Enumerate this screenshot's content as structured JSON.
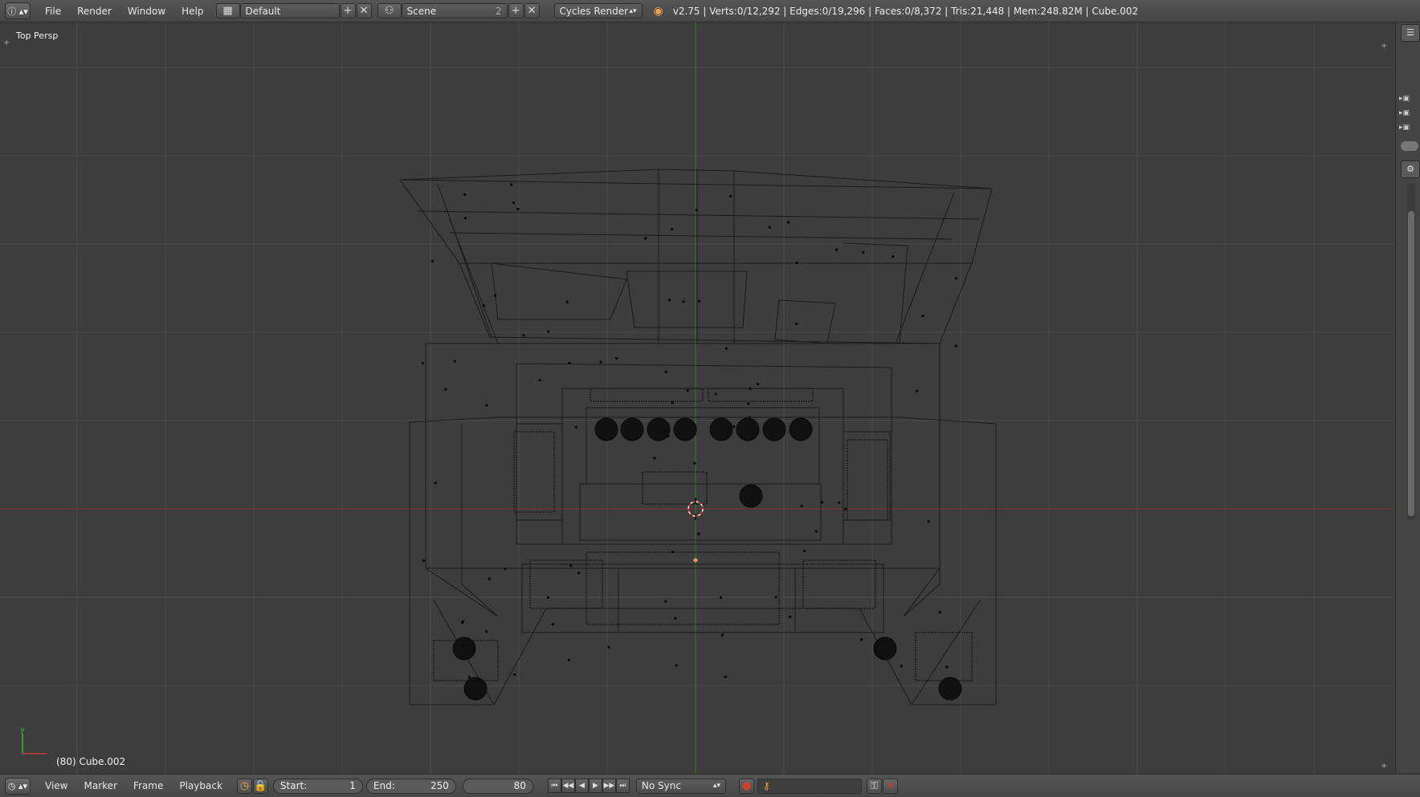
{
  "topbar": {
    "info_icon": "info-icon",
    "menus": [
      "File",
      "Render",
      "Window",
      "Help"
    ],
    "screen_layout": "Default",
    "scene": "Scene",
    "scene_users": "2",
    "render_engine": "Cycles Render",
    "stats": "v2.75 | Verts:0/12,292 | Edges:0/19,296 | Faces:0/8,372 | Tris:21,448 | Mem:248.82M | Cube.002"
  },
  "viewport": {
    "view_label": "Top Persp",
    "object_label": "(80) Cube.002",
    "axis_y_label": "y",
    "background": "#3d3d3d",
    "grid_color": "#4a4a4a",
    "x_axis_color": "#7a2f2f",
    "y_axis_color": "#3a7a2f",
    "wire_color": "#111111"
  },
  "bottombar": {
    "menus": [
      "View",
      "Marker",
      "Frame",
      "Playback"
    ],
    "start_label": "Start:",
    "start_value": "1",
    "end_label": "End:",
    "end_value": "250",
    "current_frame": "80",
    "sync": "No Sync"
  }
}
